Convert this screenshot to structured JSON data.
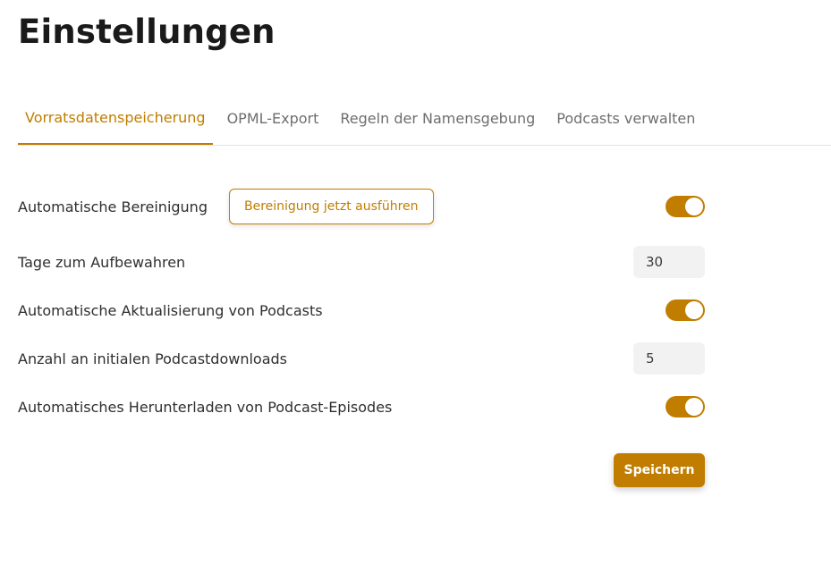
{
  "page": {
    "title": "Einstellungen"
  },
  "tabs": [
    {
      "label": "Vorratsdatenspeicherung",
      "active": true
    },
    {
      "label": "OPML-Export",
      "active": false
    },
    {
      "label": "Regeln der Namensgebung",
      "active": false
    },
    {
      "label": "Podcasts verwalten",
      "active": false
    }
  ],
  "settings": {
    "auto_cleanup": {
      "label": "Automatische Bereinigung",
      "button_label": "Bereinigung jetzt ausführen",
      "enabled": true
    },
    "retention_days": {
      "label": "Tage zum Aufbewahren",
      "value": "30"
    },
    "auto_update": {
      "label": "Automatische Aktualisierung von Podcasts",
      "enabled": true
    },
    "initial_downloads": {
      "label": "Anzahl an initialen Podcastdownloads",
      "value": "5"
    },
    "auto_download": {
      "label": "Automatisches Herunterladen von Podcast-Episodes",
      "enabled": true
    }
  },
  "actions": {
    "save_label": "Speichern"
  },
  "colors": {
    "accent": "#c07d00",
    "input_bg": "#f2f2f2",
    "tab_inactive": "#6e6e6e"
  }
}
